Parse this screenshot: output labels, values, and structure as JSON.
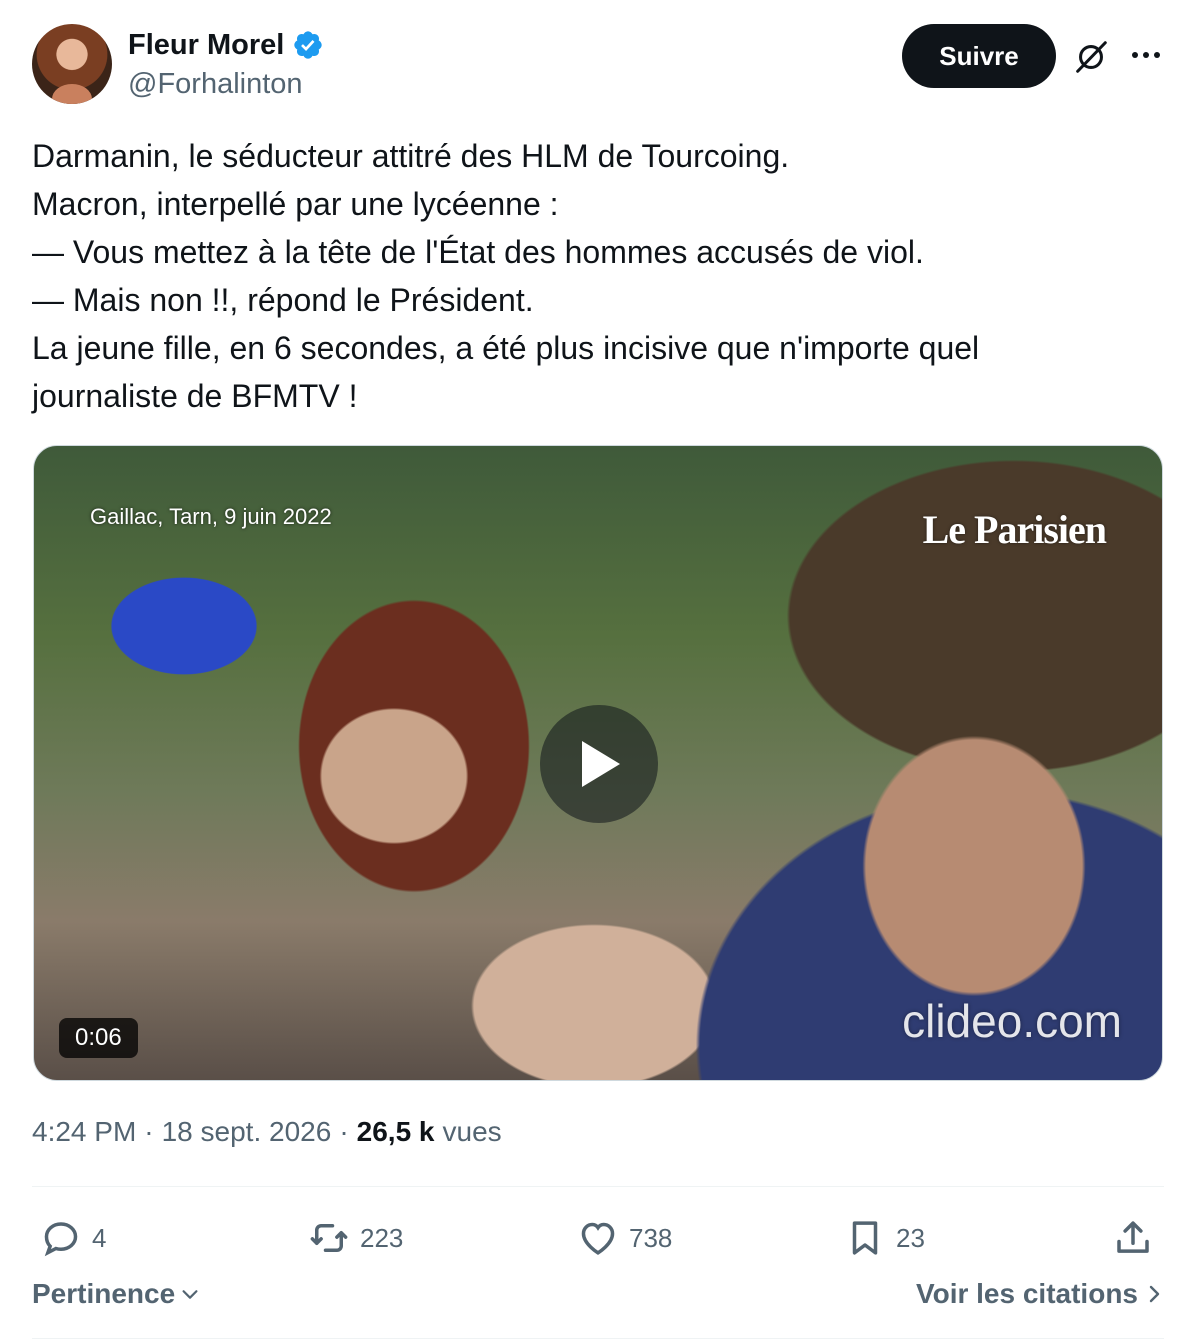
{
  "author": {
    "display_name": "Fleur Morel",
    "handle": "@Forhalinton",
    "verified": true,
    "verified_color": "#1d9bf0",
    "avatar_icon": "profile-photo"
  },
  "header": {
    "follow_label": "Suivre",
    "grok_icon": "grok-icon",
    "more_icon": "more-icon"
  },
  "tweet": {
    "lines": [
      "Darmanin, le séducteur attitré des HLM de Tourcoing.",
      "Macron, interpellé par une lycéenne :",
      "— Vous mettez à la tête de l'État des hommes accusés de viol.",
      "— Mais non !!, répond le Président.",
      "La jeune fille, en 6 secondes, a été plus incisive que n'importe quel",
      "journaliste de BFMTV !"
    ]
  },
  "media": {
    "dateline": "Gaillac, Tarn, 9 juin 2022",
    "brand": "Le Parisien",
    "watermark": "clideo.com",
    "duration": "0:06",
    "play_icon": "play-icon"
  },
  "meta": {
    "time": "4:24 PM",
    "separator": "·",
    "date": "18 sept. 2026",
    "views_count": "26,5 k",
    "views_label": "vues"
  },
  "actions": {
    "replies": "4",
    "reposts": "223",
    "likes": "738",
    "bookmarks": "23"
  },
  "footer": {
    "sort_label": "Pertinence",
    "quotes_label": "Voir les citations"
  },
  "colors": {
    "text_primary": "#0f1419",
    "text_secondary": "#536471",
    "follow_bg": "#0f1419",
    "divider": "#eff3f4"
  }
}
